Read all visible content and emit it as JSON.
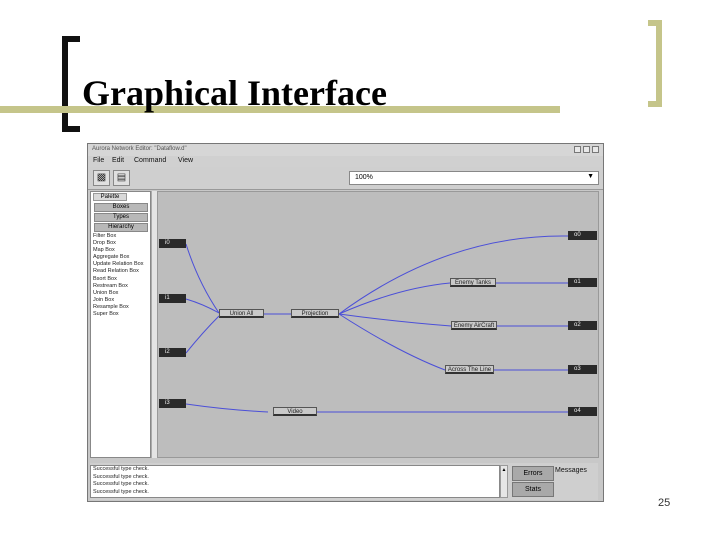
{
  "slide": {
    "title": "Graphical Interface",
    "page_number": "25",
    "accent_color": "#c5c58a"
  },
  "window": {
    "title": "Aurora Network Editor: \"Dataflow.d\"",
    "menu": [
      "File",
      "Edit",
      "Command",
      "View"
    ],
    "toolbar": {
      "save_icon": "disk-icon",
      "open_icon": "folder-icon",
      "zoom": "100%"
    }
  },
  "palette": {
    "header": "Palette",
    "tabs": [
      "Boxes",
      "Types",
      "Hierarchy"
    ],
    "items": [
      "Filter Box",
      "Drop Box",
      "Map Box",
      "Aggregate Box",
      "Update Relation Box",
      "Read Relation Box",
      "Bsort Box",
      "Restream Box",
      "Union Box",
      "Join Box",
      "Resample Box",
      "Super Box"
    ]
  },
  "diagram": {
    "inputs": [
      "i0",
      "i1",
      "i2",
      "i3"
    ],
    "outputs": [
      "o0",
      "o1",
      "o2",
      "o3",
      "o4"
    ],
    "boxes": [
      "Union All",
      "Projection",
      "Enemy Tanks",
      "Enemy AirCraft",
      "Across The Line",
      "Video"
    ],
    "edge_color": "#4b4fd8"
  },
  "messages": {
    "lines": [
      "Successful type check.",
      "Successful type check.",
      "Successful type check.",
      "Successful type check."
    ],
    "errors_button": "Errors",
    "stats_button": "Stats",
    "label": "Messages"
  }
}
